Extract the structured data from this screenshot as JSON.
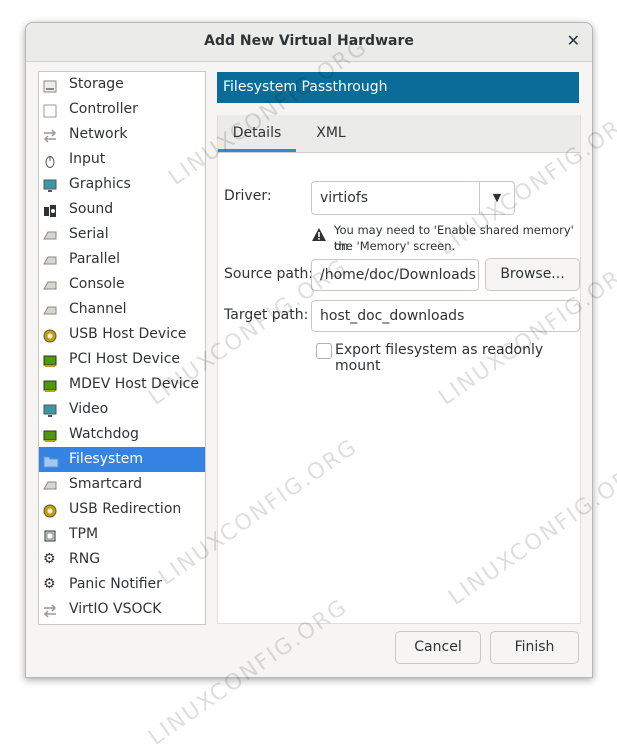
{
  "window": {
    "title": "Add New Virtual Hardware"
  },
  "hardware_list": [
    {
      "label": "Storage",
      "icon": "storage-icon"
    },
    {
      "label": "Controller",
      "icon": "controller-icon"
    },
    {
      "label": "Network",
      "icon": "network-icon"
    },
    {
      "label": "Input",
      "icon": "mouse-icon"
    },
    {
      "label": "Graphics",
      "icon": "monitor-icon"
    },
    {
      "label": "Sound",
      "icon": "sound-icon"
    },
    {
      "label": "Serial",
      "icon": "serial-icon"
    },
    {
      "label": "Parallel",
      "icon": "parallel-icon"
    },
    {
      "label": "Console",
      "icon": "console-icon"
    },
    {
      "label": "Channel",
      "icon": "channel-icon"
    },
    {
      "label": "USB Host Device",
      "icon": "usb-icon"
    },
    {
      "label": "PCI Host Device",
      "icon": "pci-card-icon"
    },
    {
      "label": "MDEV Host Device",
      "icon": "mdev-card-icon"
    },
    {
      "label": "Video",
      "icon": "video-icon"
    },
    {
      "label": "Watchdog",
      "icon": "watchdog-icon"
    },
    {
      "label": "Filesystem",
      "icon": "folder-icon",
      "selected": true
    },
    {
      "label": "Smartcard",
      "icon": "smartcard-icon"
    },
    {
      "label": "USB Redirection",
      "icon": "usb-redirection-icon"
    },
    {
      "label": "TPM",
      "icon": "chip-icon"
    },
    {
      "label": "RNG",
      "icon": "gear-icon"
    },
    {
      "label": "Panic Notifier",
      "icon": "gear-icon"
    },
    {
      "label": "VirtIO VSOCK",
      "icon": "network-icon"
    }
  ],
  "detail": {
    "header": "Filesystem Passthrough",
    "tabs": {
      "details": "Details",
      "xml": "XML"
    },
    "driver_label": "Driver:",
    "driver_value": "virtiofs",
    "warning_text_1": "You may need to 'Enable shared memory' on",
    "warning_text_2": "the 'Memory' screen.",
    "source_label": "Source path:",
    "source_value": "/home/doc/Downloads",
    "browse_label": "Browse...",
    "target_label": "Target path:",
    "target_value": "host_doc_downloads",
    "readonly_label": "Export filesystem as readonly mount"
  },
  "footer": {
    "cancel": "Cancel",
    "finish": "Finish"
  },
  "watermark": "LINUXCONFIG.ORG",
  "colors": {
    "selection": "#3584e4",
    "header": "#0a6d99"
  }
}
